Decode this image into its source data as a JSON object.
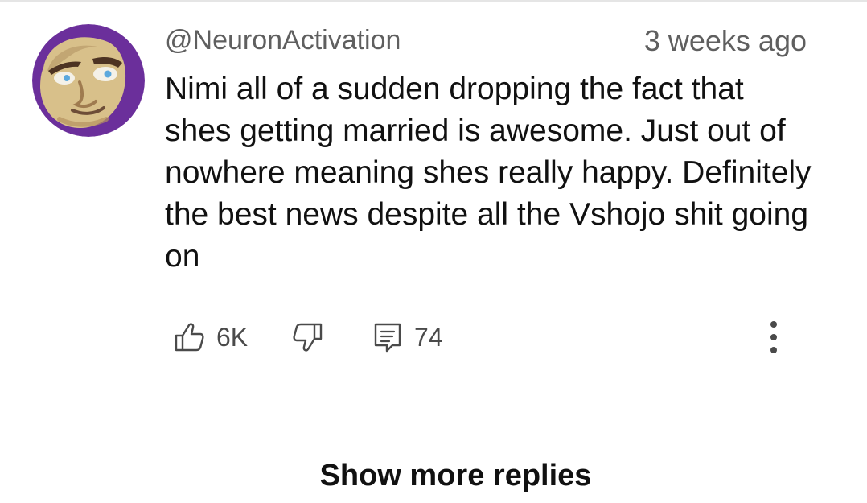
{
  "comment": {
    "author": "@NeuronActivation",
    "timestamp": "3 weeks ago",
    "avatar_icon": "cartoon-spaceman-avatar-icon",
    "text": "Nimi all of a sudden dropping the fact that shes getting married is awesome. Just out of nowhere meaning shes really happy. Definitely the best news despite all the Vshojo shit going on"
  },
  "actions": {
    "like_icon": "thumbs-up-icon",
    "like_count": "6K",
    "dislike_icon": "thumbs-down-icon",
    "reply_icon": "comment-reply-icon",
    "reply_count": "74",
    "more_icon": "more-vertical-icon"
  },
  "replies": {
    "show_more_label": "Show more replies"
  },
  "colors": {
    "primary_text": "#111111",
    "secondary_text": "#5f5f5f",
    "icon": "#4a4a4a",
    "background": "#ffffff",
    "divider": "#e5e5e5"
  }
}
